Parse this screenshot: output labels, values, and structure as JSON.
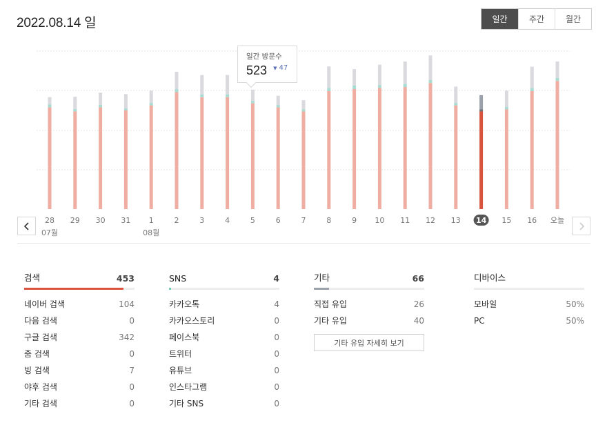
{
  "header": {
    "date_title": "2022.08.14 일"
  },
  "period_tabs": [
    {
      "label": "일간",
      "active": true
    },
    {
      "label": "주간",
      "active": false
    },
    {
      "label": "월간",
      "active": false
    }
  ],
  "tooltip": {
    "label": "일간 방문수",
    "value": "523",
    "change": "47",
    "change_direction": "down"
  },
  "chart_data": {
    "type": "bar",
    "stacked": true,
    "categories": [
      "28",
      "29",
      "30",
      "31",
      "1",
      "2",
      "3",
      "4",
      "5",
      "6",
      "7",
      "8",
      "9",
      "10",
      "11",
      "12",
      "13",
      "14",
      "15",
      "16",
      "오늘"
    ],
    "month_labels": [
      {
        "index": 0,
        "label": "07월"
      },
      {
        "index": 4,
        "label": "08월"
      }
    ],
    "selected_index": 17,
    "series": [
      {
        "values": [
          500,
          480,
          500,
          485,
          510,
          575,
          550,
          550,
          520,
          500,
          480,
          580,
          590,
          595,
          600,
          620,
          510,
          480,
          490,
          580,
          630
        ]
      },
      {
        "values": [
          15,
          12,
          12,
          10,
          12,
          15,
          14,
          14,
          12,
          12,
          10,
          16,
          18,
          15,
          15,
          15,
          12,
          10,
          12,
          15,
          15
        ]
      },
      {
        "values": [
          35,
          60,
          60,
          70,
          60,
          85,
          95,
          95,
          55,
          45,
          45,
          105,
          80,
          100,
          110,
          120,
          80,
          70,
          80,
          105,
          80
        ]
      }
    ],
    "colors": [
      "#f0ada1",
      "#a8dcd2",
      "#d9d9de"
    ],
    "selected_colors": [
      "#d9533f",
      "#6b737b",
      "#9aa1ab"
    ],
    "ylim": [
      0,
      875
    ],
    "grid": true
  },
  "panels": [
    {
      "title": "검색",
      "total": "453",
      "bar_color": "#d9533f",
      "bar_fill": 0.9,
      "rows": [
        {
          "label": "네이버 검색",
          "value": "104"
        },
        {
          "label": "다음 검색",
          "value": "0"
        },
        {
          "label": "구글 검색",
          "value": "342"
        },
        {
          "label": "줌 검색",
          "value": "0"
        },
        {
          "label": "빙 검색",
          "value": "7"
        },
        {
          "label": "야후 검색",
          "value": "0"
        },
        {
          "label": "기타 검색",
          "value": "0"
        }
      ]
    },
    {
      "title": "SNS",
      "total": "4",
      "bar_color": "#6fcfb4",
      "bar_fill": 0.02,
      "rows": [
        {
          "label": "카카오톡",
          "value": "4"
        },
        {
          "label": "카카오스토리",
          "value": "0"
        },
        {
          "label": "페이스북",
          "value": "0"
        },
        {
          "label": "트위터",
          "value": "0"
        },
        {
          "label": "유튜브",
          "value": "0"
        },
        {
          "label": "인스타그램",
          "value": "0"
        },
        {
          "label": "기타 SNS",
          "value": "0"
        }
      ]
    },
    {
      "title": "기타",
      "total": "66",
      "bar_color": "#9aa1ab",
      "bar_fill": 0.14,
      "rows": [
        {
          "label": "직접 유입",
          "value": "26"
        },
        {
          "label": "기타 유입",
          "value": "40"
        }
      ],
      "detail_button": "기타 유입 자세히 보기"
    },
    {
      "title": "디바이스",
      "total": "",
      "rows": [
        {
          "label": "모바일",
          "value": "50%"
        },
        {
          "label": "PC",
          "value": "50%"
        }
      ]
    }
  ],
  "icons": {
    "prev": "chevron-left-icon",
    "next": "chevron-right-icon",
    "down_triangle": "triangle-down-icon"
  }
}
